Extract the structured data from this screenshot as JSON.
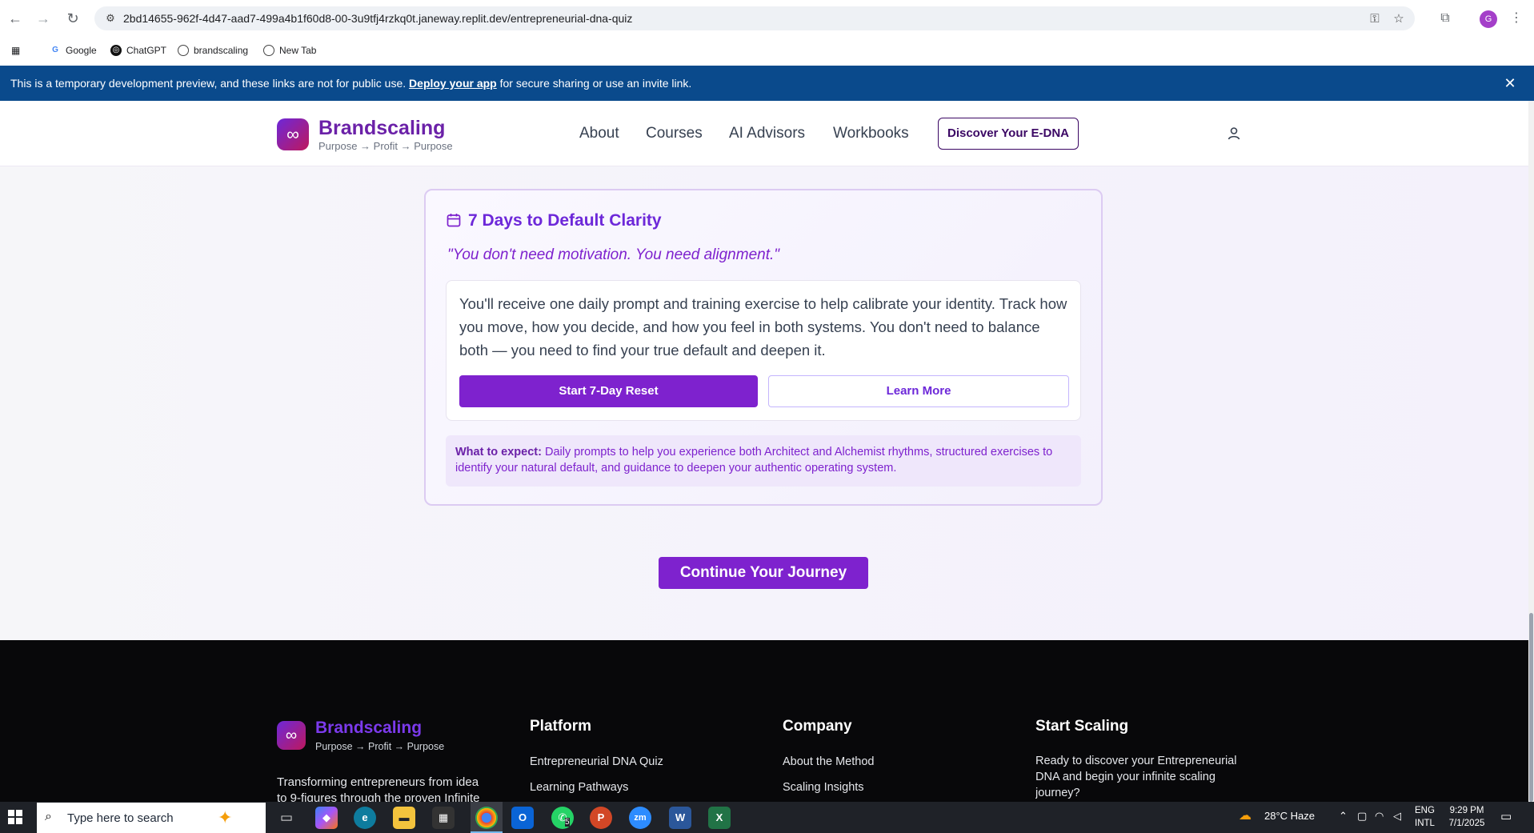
{
  "browser": {
    "url": "2bd14655-962f-4d47-aad7-499a4b1f60d8-00-3u9tfj4rzkq0t.janeway.replit.dev/entrepreneurial-dna-quiz",
    "avatar_initial": "G",
    "bookmarks": [
      "Google",
      "ChatGPT",
      "brandscaling",
      "New Tab"
    ]
  },
  "banner": {
    "text_before": "This is a temporary development preview, and these links are not for public use. ",
    "link": "Deploy your app",
    "text_after": " for secure sharing or use an invite link."
  },
  "header": {
    "brand": "Brandscaling",
    "tagline": "Purpose → Profit → Purpose",
    "nav": [
      "About",
      "Courses",
      "AI Advisors",
      "Workbooks"
    ],
    "cta": "Discover Your E-DNA"
  },
  "card": {
    "title": "7 Days to Default Clarity",
    "quote": "\"You don't need motivation. You need alignment.\"",
    "body": "You'll receive one daily prompt and training exercise to help calibrate your identity. Track how you move, how you decide, and how you feel in both systems. You don't need to balance both — you need to find your true default and deepen it.",
    "primary_button": "Start 7-Day Reset",
    "secondary_button": "Learn More",
    "expect_label": "What to expect:",
    "expect_text": " Daily prompts to help you experience both Architect and Alchemist rhythms, structured exercises to identify your natural default, and guidance to deepen your authentic operating system."
  },
  "continue_button": "Continue Your Journey",
  "footer": {
    "brand": "Brandscaling",
    "tagline": "Purpose → Profit → Purpose",
    "description": "Transforming entrepreneurs from idea to 9-figures through the proven Infinite",
    "platform": {
      "title": "Platform",
      "links": [
        "Entrepreneurial DNA Quiz",
        "Learning Pathways"
      ]
    },
    "company": {
      "title": "Company",
      "links": [
        "About the Method",
        "Scaling Insights"
      ]
    },
    "start": {
      "title": "Start Scaling",
      "text": "Ready to discover your Entrepreneurial DNA and begin your infinite scaling journey?"
    }
  },
  "taskbar": {
    "search_placeholder": "Type here to search",
    "weather": "28°C  Haze",
    "lang_top": "ENG",
    "lang_bottom": "INTL",
    "time": "9:29 PM",
    "date": "7/1/2025",
    "whatsapp_badge": "5"
  },
  "colors": {
    "accent": "#7e22ce",
    "banner": "#0a4a8c",
    "footer_bg": "#08080a"
  }
}
